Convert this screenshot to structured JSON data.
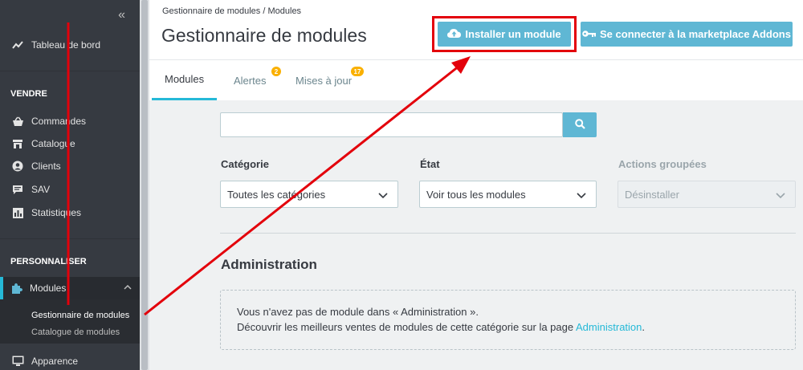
{
  "sidebar": {
    "collapse_icon": "double-chevron-left-icon",
    "dashboard_label": "Tableau de bord",
    "section_sell": "VENDRE",
    "sell_items": [
      {
        "label": "Commandes",
        "icon": "basket-icon"
      },
      {
        "label": "Catalogue",
        "icon": "store-icon"
      },
      {
        "label": "Clients",
        "icon": "user-circle-icon"
      },
      {
        "label": "SAV",
        "icon": "chat-icon"
      },
      {
        "label": "Statistiques",
        "icon": "bar-chart-icon"
      }
    ],
    "section_customize": "PERSONNALISER",
    "modules_label": "Modules",
    "sub_items": [
      "Gestionnaire de modules",
      "Catalogue de modules"
    ],
    "appearance_label": "Apparence",
    "accent_color": "#25b9d7"
  },
  "header": {
    "breadcrumb_parent": "Gestionnaire de modules",
    "breadcrumb_separator": "/",
    "breadcrumb_current": "Modules",
    "title": "Gestionnaire de modules",
    "install_button": "Installer un module",
    "install_icon": "cloud-upload-icon",
    "addons_button": "Se connecter à la marketplace Addons",
    "addons_icon": "key-icon"
  },
  "tabs": [
    {
      "label": "Modules",
      "active": true
    },
    {
      "label": "Alertes",
      "badge": "2"
    },
    {
      "label": "Mises à jour",
      "badge": "17"
    }
  ],
  "filters": {
    "search_value": "",
    "category_label": "Catégorie",
    "category_value": "Toutes les catégories",
    "state_label": "État",
    "state_value": "Voir tous les modules",
    "bulk_label": "Actions groupées",
    "bulk_value": "Désinstaller"
  },
  "content": {
    "section_title": "Administration",
    "empty_line1": "Vous n'avez pas de module dans « Administration ».",
    "empty_line2_prefix": "Découvrir les meilleurs ventes de modules de cette catégorie sur la page",
    "empty_line2_link": "Administration",
    "empty_line2_suffix": "."
  },
  "colors": {
    "button": "#5fb7d4",
    "annotation": "#e3000b",
    "badge": "#fab000"
  }
}
